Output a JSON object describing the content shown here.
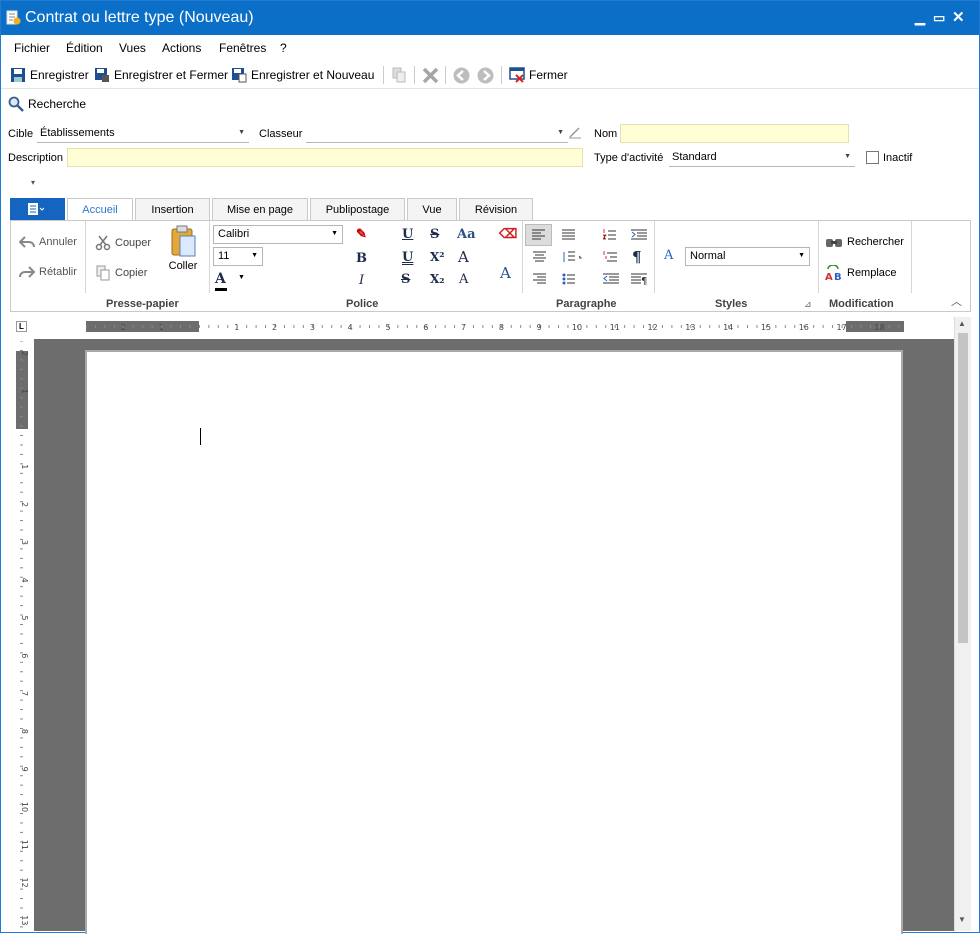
{
  "window": {
    "title": "Contrat ou lettre type (Nouveau)"
  },
  "menu": [
    "Fichier",
    "Édition",
    "Vues",
    "Actions",
    "Fenêtres",
    "?"
  ],
  "toolbar": {
    "save": "Enregistrer",
    "save_close": "Enregistrer et Fermer",
    "save_new": "Enregistrer et Nouveau",
    "close": "Fermer"
  },
  "search": {
    "label": "Recherche"
  },
  "form": {
    "cible_label": "Cible",
    "cible_value": "Établissements",
    "classeur_label": "Classeur",
    "classeur_value": "",
    "nom_label": "Nom",
    "nom_value": "",
    "description_label": "Description",
    "description_value": "",
    "type_label": "Type d'activité",
    "type_value": "Standard",
    "inactif_label": "Inactif"
  },
  "ribbon": {
    "tabs": [
      "Accueil",
      "Insertion",
      "Mise en page",
      "Publipostage",
      "Vue",
      "Révision"
    ],
    "clipboard": {
      "undo": "Annuler",
      "redo": "Rétablir",
      "cut": "Couper",
      "copy": "Copier",
      "paste": "Coller",
      "group": "Presse-papier"
    },
    "font": {
      "name": "Calibri",
      "size": "11",
      "group": "Police"
    },
    "paragraph": {
      "group": "Paragraphe"
    },
    "styles": {
      "value": "Normal",
      "group": "Styles"
    },
    "editing": {
      "find": "Rechercher",
      "replace": "Remplace",
      "group": "Modification"
    }
  },
  "ruler": {
    "h": [
      "2",
      "1",
      "1",
      "2",
      "3",
      "4",
      "5",
      "6",
      "7",
      "8",
      "9",
      "10",
      "11",
      "12",
      "13",
      "14",
      "15",
      "16",
      "17",
      "18"
    ],
    "v": [
      "2",
      "1",
      "1",
      "2",
      "3",
      "4",
      "5",
      "6",
      "7",
      "8",
      "9",
      "10",
      "11",
      "12",
      "13"
    ]
  },
  "colors": {
    "title_bg": "#0b6fc8",
    "accent": "#2a7bd0",
    "field_yellow": "#fffed5"
  }
}
